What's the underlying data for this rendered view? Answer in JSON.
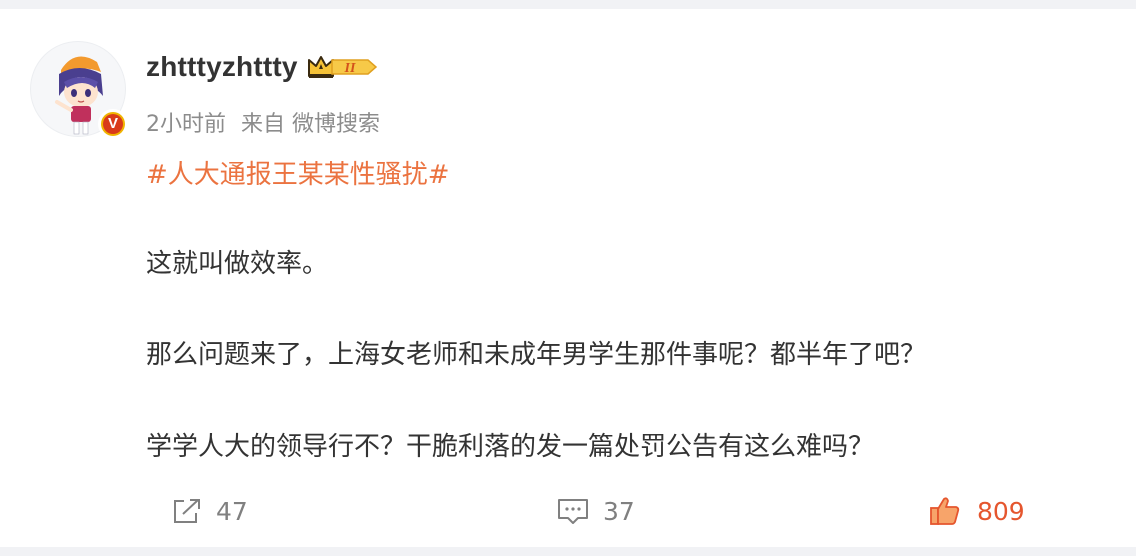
{
  "post": {
    "username": "zhtttyzhttty",
    "member_level": "II",
    "time": "2小时前",
    "source": "来自 微博搜索",
    "topic": "#人大通报王某某性骚扰#",
    "paragraphs": [
      "这就叫做效率。",
      "那么问题来了，上海女老师和未成年男学生那件事呢？都半年了吧？",
      "学学人大的领导行不？干脆利落的发一篇处罚公告有这么难吗？"
    ],
    "verified_badge": "V"
  },
  "actions": {
    "repost_count": "47",
    "comment_count": "37",
    "like_count": "809"
  },
  "colors": {
    "topic": "#eb7340",
    "like": "#e5562e",
    "text": "#333333",
    "meta": "#8c8c8c"
  }
}
